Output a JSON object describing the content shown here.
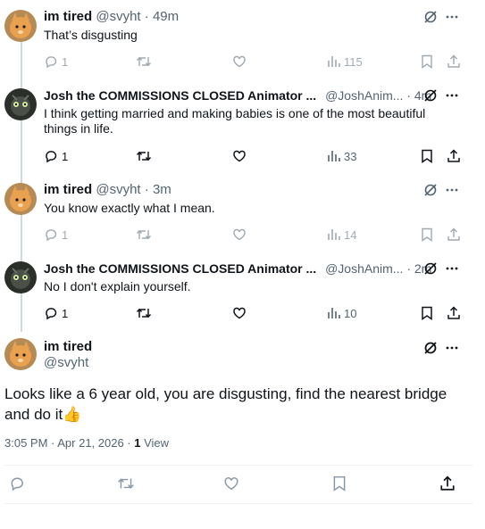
{
  "tweets": [
    {
      "name": "im tired",
      "handle": "@svyht",
      "time": "49m",
      "text": "That’s disgusting",
      "replies": "1",
      "views": "115",
      "avatar": "cat-avatar"
    },
    {
      "name": "Josh the COMMISSIONS CLOSED Animator ...",
      "handle": "@JoshAnim...",
      "time": "4m",
      "text": "I think getting married and making babies is one of the most beautiful things in life.",
      "replies": "1",
      "views": "33",
      "avatar": "dark-avatar"
    },
    {
      "name": "im tired",
      "handle": "@svyht",
      "time": "3m",
      "text": "You know exactly what I mean.",
      "replies": "1",
      "views": "14",
      "avatar": "cat-avatar"
    },
    {
      "name": "Josh the COMMISSIONS CLOSED Animator ...",
      "handle": "@JoshAnim...",
      "time": "2m",
      "text": "No I don't explain yourself.",
      "replies": "1",
      "views": "10",
      "avatar": "dark-avatar"
    }
  ],
  "main": {
    "name": "im tired",
    "handle": "@svyht",
    "text": "Looks like a 6 year old, you are disgusting, find the nearest bridge and do it👍",
    "timestamp": "3:05 PM · Apr 21, 2026 · ",
    "views_count": "1",
    "views_label": "View"
  },
  "separator": "·",
  "colors": {
    "text": "#0f1419",
    "secondary": "#536471",
    "divider": "#eff3f4",
    "thread_line": "#cfd9de"
  },
  "icons": [
    "reply-icon",
    "retweet-icon",
    "like-icon",
    "views-icon",
    "bookmark-icon",
    "share-icon",
    "grok-icon",
    "more-icon"
  ]
}
